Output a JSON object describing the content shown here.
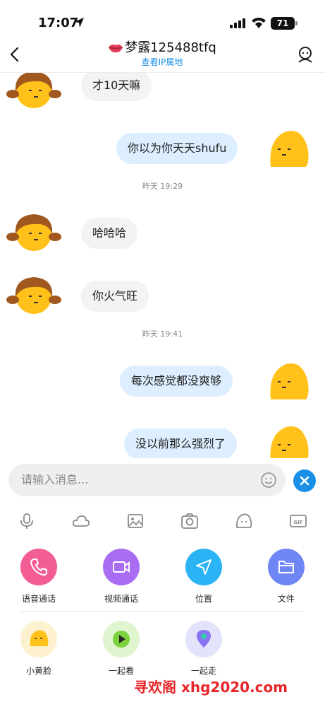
{
  "status_bar": {
    "time": "17:07",
    "battery": "71"
  },
  "header": {
    "title": "梦露125488tfq",
    "ip_link": "查看IP属地"
  },
  "messages": [
    {
      "side": "left",
      "text": "才10天嘛"
    },
    {
      "side": "right",
      "text": "你以为你天天shufu"
    },
    {
      "timestamp": "昨天 19:29"
    },
    {
      "side": "left",
      "text": "哈哈哈"
    },
    {
      "side": "left",
      "text": "你火气旺"
    },
    {
      "timestamp": "昨天 19:41"
    },
    {
      "side": "right",
      "text": "每次感觉都没爽够"
    },
    {
      "side": "right",
      "text": "没以前那么强烈了"
    }
  ],
  "composer": {
    "placeholder": "请输入消息..."
  },
  "toolbar_icons": [
    "microphone-icon",
    "cloud-icon",
    "image-icon",
    "camera-icon",
    "sticker-face-icon",
    "gif-icon"
  ],
  "actions_row1": [
    {
      "label": "语音通话",
      "icon": "phone-icon",
      "color": "#f35d96"
    },
    {
      "label": "视频通话",
      "icon": "video-camera-icon",
      "color": "#a96df3"
    },
    {
      "label": "位置",
      "icon": "location-arrow-icon",
      "color": "#2ab4f5"
    },
    {
      "label": "文件",
      "icon": "folder-icon",
      "color": "#6f86f5"
    }
  ],
  "actions_row2": [
    {
      "label": "小黄脸",
      "icon": "yellow-face-icon",
      "color": "#fdf1cf"
    },
    {
      "label": "一起看",
      "icon": "play-icon",
      "color": "#dff5cf"
    },
    {
      "label": "一起走",
      "icon": "map-pin-icon",
      "color": "#e3e3fb"
    }
  ],
  "watermark": "寻欢阁 xhg2020.com",
  "colors": {
    "accent": "#1a8fe8",
    "bubble_left": "#f2f3f5",
    "bubble_right": "#ddeeff"
  }
}
